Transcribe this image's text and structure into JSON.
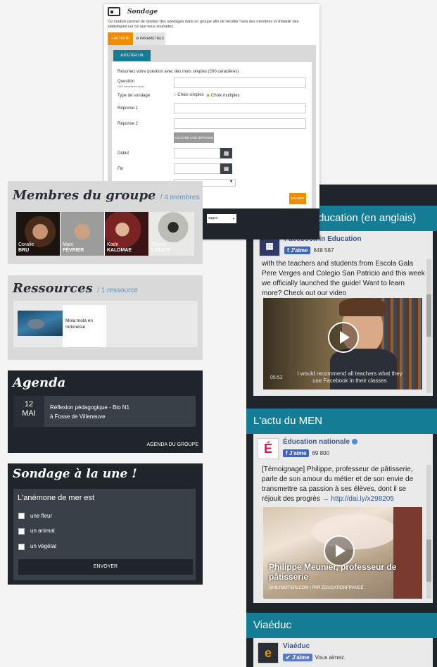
{
  "sondage": {
    "title": "Sondage",
    "description": "Ce module permet de réaliser des sondages dans un groupe afin de récolter l'avis des membres et d'établir des statistiques sur ce que vous souhaitez.",
    "tab_active": "ACTIVITÉ",
    "tab_params": "PARAMÈTRES",
    "add_button": "AJOUTER UN SONDAGE",
    "question_hint": "Résumez votre question avec des mots simples (200 caractères)",
    "question_label": "Question",
    "question_sub": "(200 caractères max)",
    "type_label": "Type de sondage",
    "type_simple": "Choix simples",
    "type_multiple": "Choix multiples",
    "reponse1": "Réponse 1",
    "reponse2": "Réponse 2",
    "add_reponse": "AJOUTER UNE RÉPONSE",
    "debut": "Début",
    "fin": "Fin",
    "validate": "VALIDER",
    "select_text": "sages"
  },
  "membres": {
    "title": "Membres du groupe",
    "count": "/ 4 membres",
    "people": [
      {
        "first": "Coralie",
        "last": "BRU",
        "color": "#6b3b22"
      },
      {
        "first": "Marc",
        "last": "FÉVRIER",
        "color": "#b8b6b2"
      },
      {
        "first": "Kadri",
        "last": "KALDMAE",
        "color": "#8b2d2d"
      },
      {
        "first": "Thierry",
        "last": "LAFAYE",
        "color": "#d9d9d4"
      }
    ]
  },
  "ressources": {
    "title": "Ressources",
    "count": "/ 1 ressource",
    "item": "Mola mola en Indonésie"
  },
  "agenda": {
    "title": "Agenda",
    "day": "12",
    "month": "MAI",
    "event_line1": "Réflexion pédagogique - Bio N1",
    "event_line2": "à Fosse de Villeneuve",
    "link": "AGENDA DU GROUPE"
  },
  "poll": {
    "title": "Sondage à la une !",
    "question": "L'anémone de mer est",
    "options": [
      "une fleur",
      "un animal",
      "un végétal"
    ],
    "submit": "ENVOYER"
  },
  "fb": {
    "partial_label": "e",
    "header1": "ducation (en anglais)",
    "page1_name": "Facebook in Education",
    "like_label": "J'aime",
    "page1_likes": "648 587",
    "post1": "with the teachers and students from Escola Gala Pere Verges and Colegio San Patricio and this week we officially launched the guide! Want to learn more? Check out our video",
    "video1_time": "05:52",
    "video1_caption": "I would recommend all teachers what they use Facebook in their classes",
    "header2": "L'actu du MEN",
    "page2_name": "Éducation nationale",
    "page2_likes": "69 800",
    "post2": "[Témoignage] Philippe, professeur de pâtisserie, parle de son amour du métier et de son envie de transmettre sa passion à ses élèves, dont il se réjouit des progrès → ",
    "post2_link": "http://dai.ly/x298205",
    "video2_title": "Philippe Meunier, professeur de pâtisserie",
    "video2_source": "DAILYMOTION.COM  |  PAR EDUCATIONFRANCE",
    "header3": "Viaéduc",
    "page3_name": "Viaéduc",
    "page3_like": "J'aime",
    "page3_status": "Vous aimez."
  },
  "colors": {
    "accent_orange": "#f08c00",
    "teal": "#167d96",
    "dark": "#1f252b",
    "fb_blue": "#4267b2"
  }
}
